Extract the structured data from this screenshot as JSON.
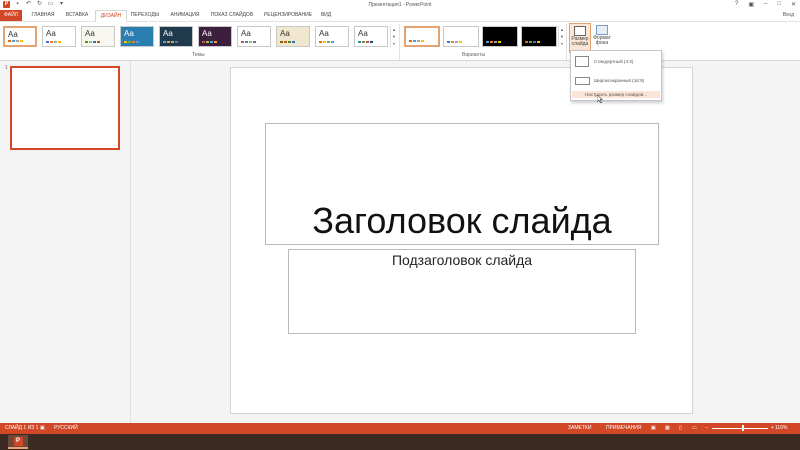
{
  "window": {
    "title": "Презентация1 - PowerPoint",
    "user": "Вход",
    "app_icon_letter": "P"
  },
  "menu": {
    "tabs": [
      "ФАЙЛ",
      "ГЛАВНАЯ",
      "ВСТАВКА",
      "ДИЗАЙН",
      "ПЕРЕХОДЫ",
      "АНИМАЦИЯ",
      "ПОКАЗ СЛАЙДОВ",
      "РЕЦЕНЗИРОВАНИЕ",
      "ВИД"
    ],
    "active": "ДИЗАЙН"
  },
  "ribbon": {
    "themes_label": "Темы",
    "variants_label": "Варианты",
    "theme_sample": "Aa",
    "themes": [
      {
        "bg": "#ffffff",
        "fg": "#333333",
        "accents": [
          "#e36c09",
          "#5b9bd5",
          "#a5a5a5",
          "#ffc000"
        ]
      },
      {
        "bg": "#ffffff",
        "fg": "#333333",
        "accents": [
          "#4472c4",
          "#ed7d31",
          "#a5a5a5",
          "#ffc000"
        ]
      },
      {
        "bg": "#f7f7f0",
        "fg": "#333333",
        "accents": [
          "#5b8c32",
          "#93c47d",
          "#2e75b6",
          "#c55a11"
        ]
      },
      {
        "bg": "#2b7fb0",
        "fg": "#ffffff",
        "accents": [
          "#ffc000",
          "#70ad47",
          "#ed7d31",
          "#5b9bd5"
        ]
      },
      {
        "bg": "#1f3a4d",
        "fg": "#ffffff",
        "accents": [
          "#4bacc6",
          "#f79646",
          "#9bbb59",
          "#8064a2"
        ]
      },
      {
        "bg": "#3b1f3d",
        "fg": "#ffffff",
        "accents": [
          "#c0504d",
          "#9bbb59",
          "#4bacc6",
          "#f79646"
        ]
      },
      {
        "bg": "#ffffff",
        "fg": "#333333",
        "accents": [
          "#c0504d",
          "#4f81bd",
          "#9bbb59",
          "#8064a2"
        ]
      },
      {
        "bg": "#f1e7d0",
        "fg": "#333333",
        "accents": [
          "#7f6000",
          "#c55a11",
          "#548235",
          "#2e75b6"
        ]
      },
      {
        "bg": "#ffffff",
        "fg": "#333333",
        "accents": [
          "#e36c09",
          "#ffc000",
          "#70ad47",
          "#5b9bd5"
        ]
      },
      {
        "bg": "#ffffff",
        "fg": "#333333",
        "accents": [
          "#31859c",
          "#76923c",
          "#c0504d",
          "#1f497d"
        ]
      }
    ],
    "variants": [
      {
        "bg": "#ffffff",
        "accents": [
          "#e36c09",
          "#5b9bd5",
          "#a5a5a5",
          "#ffc000"
        ]
      },
      {
        "bg": "#ffffff",
        "accents": [
          "#4472c4",
          "#ed7d31",
          "#a5a5a5",
          "#ffc000"
        ]
      },
      {
        "bg": "#000000",
        "accents": [
          "#5b9bd5",
          "#ed7d31",
          "#a5a5a5",
          "#ffc000"
        ]
      },
      {
        "bg": "#000000",
        "accents": [
          "#e36c09",
          "#70ad47",
          "#4472c4",
          "#ffc000"
        ]
      }
    ],
    "slide_size_label": "Размер слайда",
    "format_bg_label": "Формат фона"
  },
  "slide_size_menu": {
    "standard": "Стандартный (4:3)",
    "widescreen": "Широкоэкранный (16:9)",
    "custom": "Настроить размер слайдов..."
  },
  "slides": {
    "thumb_number": "1"
  },
  "slide": {
    "title": "Заголовок слайда",
    "subtitle": "Подзаголовок слайда"
  },
  "status": {
    "slide_info": "СЛАЙД 1 ИЗ 1",
    "language": "РУССКИЙ",
    "notes": "ЗАМЕТКИ",
    "comments": "ПРИМЕЧАНИЯ",
    "zoom": "116%"
  },
  "colors": {
    "accent": "#d24726",
    "highlight": "#fce4d6"
  }
}
